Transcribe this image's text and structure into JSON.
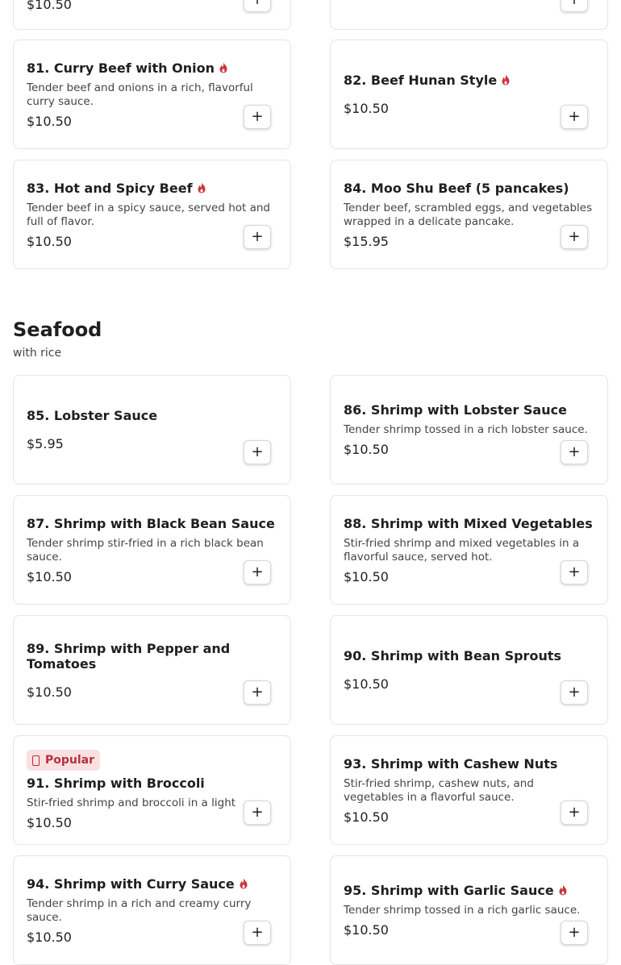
{
  "colors": {
    "spicy_icon": "#c7373f",
    "popular_badge_bg": "#fbe0e2",
    "popular_badge_text": "#b3323c"
  },
  "partial": {
    "left_price": "$10.50",
    "add_label": "+"
  },
  "beef": {
    "items": [
      {
        "title": "81. Curry Beef with Onion",
        "spicy": true,
        "desc": "Tender beef and onions in a rich, flavorful curry sauce.",
        "price": "$10.50",
        "add_label": "+"
      },
      {
        "title": "82. Beef Hunan Style",
        "spicy": true,
        "desc": "",
        "price": "$10.50",
        "add_label": "+"
      },
      {
        "title": "83. Hot and Spicy Beef",
        "spicy": true,
        "desc": "Tender beef in a spicy sauce, served hot and full of flavor.",
        "price": "$10.50",
        "add_label": "+"
      },
      {
        "title": "84. Moo Shu Beef (5 pancakes)",
        "spicy": false,
        "desc": "Tender beef, scrambled eggs, and vegetables wrapped in a delicate pancake.",
        "price": "$15.95",
        "add_label": "+"
      }
    ]
  },
  "seafood": {
    "title": "Seafood",
    "subtitle": "with rice",
    "items": [
      {
        "title": "85. Lobster Sauce",
        "spicy": false,
        "desc": "",
        "price": "$5.95",
        "add_label": "+"
      },
      {
        "title": "86. Shrimp with Lobster Sauce",
        "spicy": false,
        "desc": "Tender shrimp tossed in a rich lobster sauce.",
        "price": "$10.50",
        "add_label": "+"
      },
      {
        "title": "87. Shrimp with Black Bean Sauce",
        "spicy": false,
        "desc": "Tender shrimp stir-fried in a rich black bean sauce.",
        "price": "$10.50",
        "add_label": "+"
      },
      {
        "title": "88. Shrimp with Mixed Vegetables",
        "spicy": false,
        "desc": "Stir-fried shrimp and mixed vegetables in a flavorful sauce, served hot.",
        "price": "$10.50",
        "add_label": "+"
      },
      {
        "title": "89. Shrimp with Pepper and Tomatoes",
        "spicy": false,
        "desc": "",
        "price": "$10.50",
        "add_label": "+"
      },
      {
        "title": "90. Shrimp with Bean Sprouts",
        "spicy": false,
        "desc": "",
        "price": "$10.50",
        "add_label": "+"
      },
      {
        "badge": "Popular",
        "title": "91. Shrimp with Broccoli",
        "spicy": false,
        "desc": "Stir-fried shrimp and broccoli in a light",
        "price": "$10.50",
        "add_label": "+"
      },
      {
        "title": "93. Shrimp with Cashew Nuts",
        "spicy": false,
        "desc": "Stir-fried shrimp, cashew nuts, and vegetables in a flavorful sauce.",
        "price": "$10.50",
        "add_label": "+"
      },
      {
        "title": "94. Shrimp with Curry Sauce",
        "spicy": true,
        "desc": "Tender shrimp in a rich and creamy curry sauce.",
        "price": "$10.50",
        "add_label": "+"
      },
      {
        "title": "95. Shrimp with Garlic Sauce",
        "spicy": true,
        "desc": "Tender shrimp tossed in a rich garlic sauce.",
        "price": "$10.50",
        "add_label": "+"
      }
    ]
  }
}
